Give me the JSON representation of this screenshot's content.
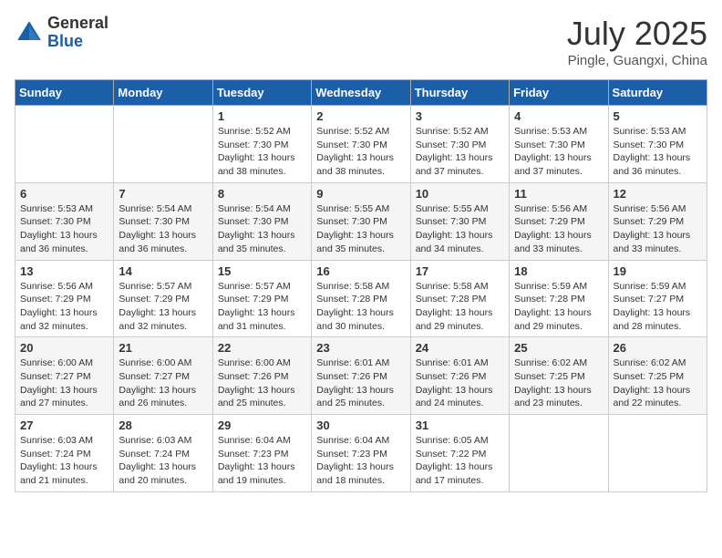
{
  "header": {
    "logo_general": "General",
    "logo_blue": "Blue",
    "month_title": "July 2025",
    "subtitle": "Pingle, Guangxi, China"
  },
  "weekdays": [
    "Sunday",
    "Monday",
    "Tuesday",
    "Wednesday",
    "Thursday",
    "Friday",
    "Saturday"
  ],
  "weeks": [
    [
      {
        "day": "",
        "info": ""
      },
      {
        "day": "",
        "info": ""
      },
      {
        "day": "1",
        "info": "Sunrise: 5:52 AM\nSunset: 7:30 PM\nDaylight: 13 hours and 38 minutes."
      },
      {
        "day": "2",
        "info": "Sunrise: 5:52 AM\nSunset: 7:30 PM\nDaylight: 13 hours and 38 minutes."
      },
      {
        "day": "3",
        "info": "Sunrise: 5:52 AM\nSunset: 7:30 PM\nDaylight: 13 hours and 37 minutes."
      },
      {
        "day": "4",
        "info": "Sunrise: 5:53 AM\nSunset: 7:30 PM\nDaylight: 13 hours and 37 minutes."
      },
      {
        "day": "5",
        "info": "Sunrise: 5:53 AM\nSunset: 7:30 PM\nDaylight: 13 hours and 36 minutes."
      }
    ],
    [
      {
        "day": "6",
        "info": "Sunrise: 5:53 AM\nSunset: 7:30 PM\nDaylight: 13 hours and 36 minutes."
      },
      {
        "day": "7",
        "info": "Sunrise: 5:54 AM\nSunset: 7:30 PM\nDaylight: 13 hours and 36 minutes."
      },
      {
        "day": "8",
        "info": "Sunrise: 5:54 AM\nSunset: 7:30 PM\nDaylight: 13 hours and 35 minutes."
      },
      {
        "day": "9",
        "info": "Sunrise: 5:55 AM\nSunset: 7:30 PM\nDaylight: 13 hours and 35 minutes."
      },
      {
        "day": "10",
        "info": "Sunrise: 5:55 AM\nSunset: 7:30 PM\nDaylight: 13 hours and 34 minutes."
      },
      {
        "day": "11",
        "info": "Sunrise: 5:56 AM\nSunset: 7:29 PM\nDaylight: 13 hours and 33 minutes."
      },
      {
        "day": "12",
        "info": "Sunrise: 5:56 AM\nSunset: 7:29 PM\nDaylight: 13 hours and 33 minutes."
      }
    ],
    [
      {
        "day": "13",
        "info": "Sunrise: 5:56 AM\nSunset: 7:29 PM\nDaylight: 13 hours and 32 minutes."
      },
      {
        "day": "14",
        "info": "Sunrise: 5:57 AM\nSunset: 7:29 PM\nDaylight: 13 hours and 32 minutes."
      },
      {
        "day": "15",
        "info": "Sunrise: 5:57 AM\nSunset: 7:29 PM\nDaylight: 13 hours and 31 minutes."
      },
      {
        "day": "16",
        "info": "Sunrise: 5:58 AM\nSunset: 7:28 PM\nDaylight: 13 hours and 30 minutes."
      },
      {
        "day": "17",
        "info": "Sunrise: 5:58 AM\nSunset: 7:28 PM\nDaylight: 13 hours and 29 minutes."
      },
      {
        "day": "18",
        "info": "Sunrise: 5:59 AM\nSunset: 7:28 PM\nDaylight: 13 hours and 29 minutes."
      },
      {
        "day": "19",
        "info": "Sunrise: 5:59 AM\nSunset: 7:27 PM\nDaylight: 13 hours and 28 minutes."
      }
    ],
    [
      {
        "day": "20",
        "info": "Sunrise: 6:00 AM\nSunset: 7:27 PM\nDaylight: 13 hours and 27 minutes."
      },
      {
        "day": "21",
        "info": "Sunrise: 6:00 AM\nSunset: 7:27 PM\nDaylight: 13 hours and 26 minutes."
      },
      {
        "day": "22",
        "info": "Sunrise: 6:00 AM\nSunset: 7:26 PM\nDaylight: 13 hours and 25 minutes."
      },
      {
        "day": "23",
        "info": "Sunrise: 6:01 AM\nSunset: 7:26 PM\nDaylight: 13 hours and 25 minutes."
      },
      {
        "day": "24",
        "info": "Sunrise: 6:01 AM\nSunset: 7:26 PM\nDaylight: 13 hours and 24 minutes."
      },
      {
        "day": "25",
        "info": "Sunrise: 6:02 AM\nSunset: 7:25 PM\nDaylight: 13 hours and 23 minutes."
      },
      {
        "day": "26",
        "info": "Sunrise: 6:02 AM\nSunset: 7:25 PM\nDaylight: 13 hours and 22 minutes."
      }
    ],
    [
      {
        "day": "27",
        "info": "Sunrise: 6:03 AM\nSunset: 7:24 PM\nDaylight: 13 hours and 21 minutes."
      },
      {
        "day": "28",
        "info": "Sunrise: 6:03 AM\nSunset: 7:24 PM\nDaylight: 13 hours and 20 minutes."
      },
      {
        "day": "29",
        "info": "Sunrise: 6:04 AM\nSunset: 7:23 PM\nDaylight: 13 hours and 19 minutes."
      },
      {
        "day": "30",
        "info": "Sunrise: 6:04 AM\nSunset: 7:23 PM\nDaylight: 13 hours and 18 minutes."
      },
      {
        "day": "31",
        "info": "Sunrise: 6:05 AM\nSunset: 7:22 PM\nDaylight: 13 hours and 17 minutes."
      },
      {
        "day": "",
        "info": ""
      },
      {
        "day": "",
        "info": ""
      }
    ]
  ]
}
